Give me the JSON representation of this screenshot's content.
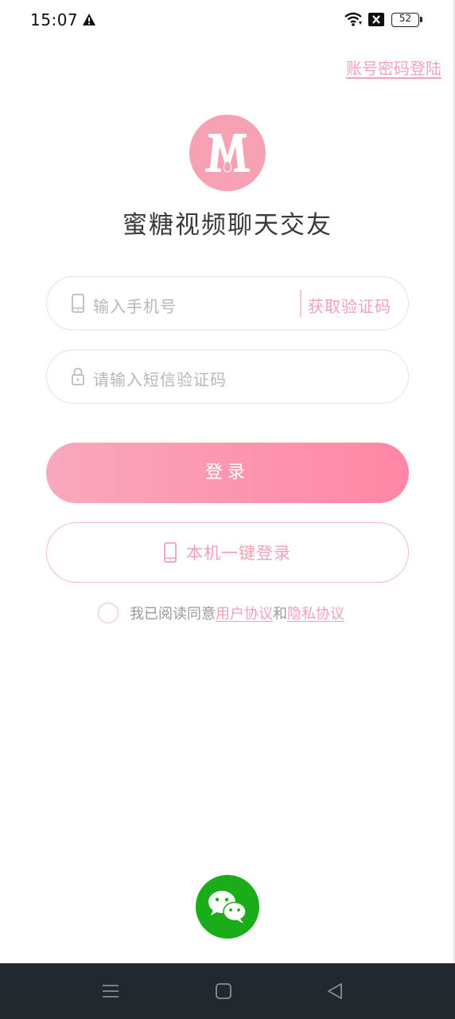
{
  "status_bar": {
    "time": "15:07",
    "battery": "52",
    "icons": [
      "warning-icon",
      "wifi-icon",
      "no-sim-icon",
      "battery-icon"
    ]
  },
  "top_link": "账号密码登陆",
  "app": {
    "logo_letter": "M",
    "title": "蜜糖视频聊天交友"
  },
  "phone_field": {
    "placeholder": "输入手机号",
    "icon": "phone-icon",
    "get_code": "获取验证码"
  },
  "code_field": {
    "placeholder": "请输入短信验证码",
    "icon": "lock-icon"
  },
  "login_button": "登录",
  "one_key_button": {
    "label": "本机一键登录",
    "icon": "phone-icon"
  },
  "agreement": {
    "prefix": "我已阅读同意",
    "user_agreement": "用户协议",
    "and": "和",
    "privacy_agreement": "隐私协议"
  },
  "wechat": {
    "icon": "wechat-icon"
  },
  "colors": {
    "accent": "#f2a2b5",
    "button_start": "#f9a8bd",
    "button_end": "#ff86a5",
    "wechat": "#1aad19",
    "navbar": "#23272e"
  }
}
